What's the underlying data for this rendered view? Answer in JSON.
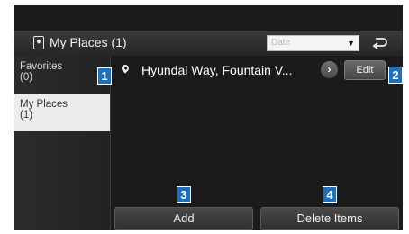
{
  "header": {
    "title": "My Places (1)",
    "sort_value": "Date",
    "sort_arrow": "▼",
    "icons": {
      "title": "my-places-icon",
      "back": "back-arrow-icon",
      "sort": "dropdown-arrow-icon"
    }
  },
  "sidebar": {
    "items": [
      {
        "label": "Favorites",
        "count": "(0)",
        "selected": false
      },
      {
        "label": "My Places",
        "count": "(1)",
        "selected": true
      }
    ]
  },
  "list": {
    "items": [
      {
        "name": "Hyundai Way, Fountain V...",
        "detail_label": "›",
        "edit_label": "Edit",
        "icon": "location-pin-icon"
      }
    ]
  },
  "buttons": {
    "add": "Add",
    "delete": "Delete Items"
  },
  "markers": [
    "1",
    "2",
    "3",
    "4"
  ],
  "colors": {
    "marker": "#1d6fc2",
    "selected_tab": "#ececec",
    "screen_bg": "#1b1b1b"
  }
}
